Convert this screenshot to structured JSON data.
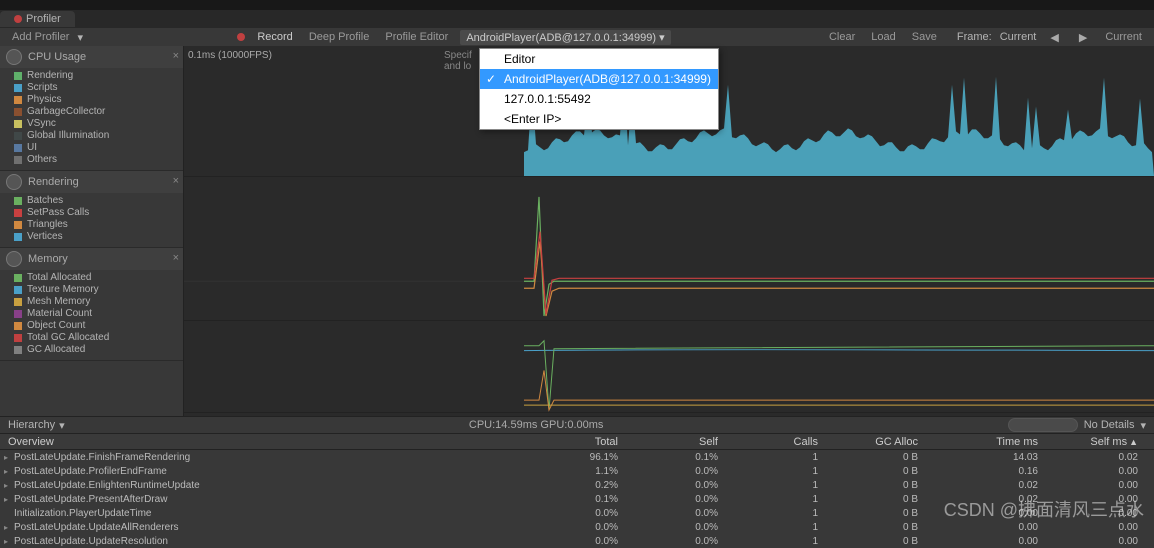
{
  "tab": {
    "title": "Profiler"
  },
  "addProfiler": "Add Profiler",
  "toolbar": {
    "record": "Record",
    "deepProfile": "Deep Profile",
    "profileEditor": "Profile Editor",
    "connected": "AndroidPlayer(ADB@127.0.0.1:34999)",
    "clear": "Clear",
    "load": "Load",
    "save": "Save",
    "frame": "Frame:",
    "current": "Current",
    "currentBtn": "Current"
  },
  "specif": "Specif\nand lo",
  "dropdown": {
    "items": [
      "Editor",
      "AndroidPlayer(ADB@127.0.0.1:34999)",
      "127.0.0.1:55492",
      "<Enter IP>"
    ],
    "selectedIndex": 1
  },
  "modules": {
    "cpu": {
      "title": "CPU Usage",
      "items": [
        {
          "label": "Rendering",
          "color": "#5fb06a"
        },
        {
          "label": "Scripts",
          "color": "#4aa0c8"
        },
        {
          "label": "Physics",
          "color": "#d08840"
        },
        {
          "label": "GarbageCollector",
          "color": "#8a5030"
        },
        {
          "label": "VSync",
          "color": "#c8c060"
        },
        {
          "label": "Global Illumination",
          "color": "#404848"
        },
        {
          "label": "UI",
          "color": "#5878a0"
        },
        {
          "label": "Others",
          "color": "#707070"
        }
      ],
      "axisLabel": "0.1ms (10000FPS)"
    },
    "rendering": {
      "title": "Rendering",
      "items": [
        {
          "label": "Batches",
          "color": "#6ab060"
        },
        {
          "label": "SetPass Calls",
          "color": "#c84040"
        },
        {
          "label": "Triangles",
          "color": "#d08840"
        },
        {
          "label": "Vertices",
          "color": "#4aa0c8"
        }
      ]
    },
    "memory": {
      "title": "Memory",
      "items": [
        {
          "label": "Total Allocated",
          "color": "#6ab060"
        },
        {
          "label": "Texture Memory",
          "color": "#4aa0c8"
        },
        {
          "label": "Mesh Memory",
          "color": "#c8a040"
        },
        {
          "label": "Material Count",
          "color": "#884088"
        },
        {
          "label": "Object Count",
          "color": "#d08840"
        },
        {
          "label": "Total GC Allocated",
          "color": "#c04040"
        },
        {
          "label": "GC Allocated",
          "color": "#808080"
        }
      ]
    }
  },
  "bottomBar": {
    "hierarchy": "Hierarchy",
    "cpuInfo": "CPU:14.59ms   GPU:0.00ms",
    "noDetails": "No Details"
  },
  "table": {
    "headers": [
      "Overview",
      "Total",
      "Self",
      "Calls",
      "GC Alloc",
      "Time ms",
      "Self ms"
    ],
    "rows": [
      {
        "name": "PostLateUpdate.FinishFrameRendering",
        "total": "96.1%",
        "self": "0.1%",
        "calls": "1",
        "gc": "0 B",
        "time": "14.03",
        "selfms": "0.02"
      },
      {
        "name": "PostLateUpdate.ProfilerEndFrame",
        "total": "1.1%",
        "self": "0.0%",
        "calls": "1",
        "gc": "0 B",
        "time": "0.16",
        "selfms": "0.00"
      },
      {
        "name": "PostLateUpdate.EnlightenRuntimeUpdate",
        "total": "0.2%",
        "self": "0.0%",
        "calls": "1",
        "gc": "0 B",
        "time": "0.02",
        "selfms": "0.00"
      },
      {
        "name": "PostLateUpdate.PresentAfterDraw",
        "total": "0.1%",
        "self": "0.0%",
        "calls": "1",
        "gc": "0 B",
        "time": "0.02",
        "selfms": "0.00"
      },
      {
        "name": "Initialization.PlayerUpdateTime",
        "total": "0.0%",
        "self": "0.0%",
        "calls": "1",
        "gc": "0 B",
        "time": "0.00",
        "selfms": "0.00",
        "noexpand": true
      },
      {
        "name": "PostLateUpdate.UpdateAllRenderers",
        "total": "0.0%",
        "self": "0.0%",
        "calls": "1",
        "gc": "0 B",
        "time": "0.00",
        "selfms": "0.00"
      },
      {
        "name": "PostLateUpdate.UpdateResolution",
        "total": "0.0%",
        "self": "0.0%",
        "calls": "1",
        "gc": "0 B",
        "time": "0.00",
        "selfms": "0.00"
      }
    ]
  },
  "watermark": "CSDN @拂面清风三点水",
  "chart_data": {
    "type": "area",
    "title": "CPU Usage",
    "ylabel": "ms",
    "note": "area chart, spiky CPU usage starting mid-graph, values approximate"
  }
}
